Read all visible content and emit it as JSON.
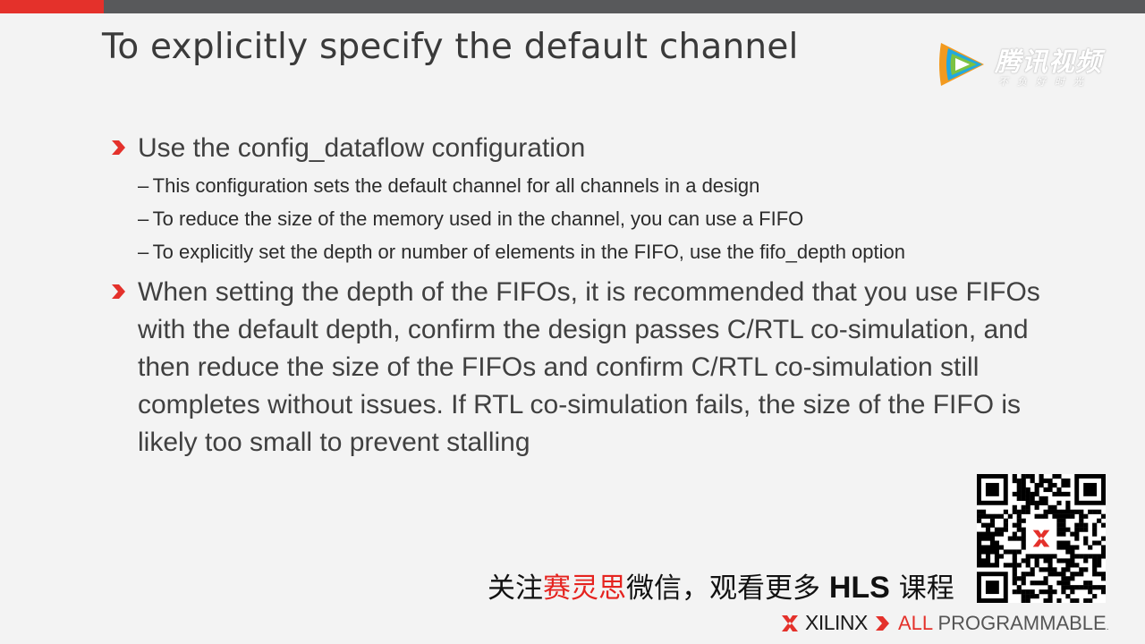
{
  "slide": {
    "title": "To explicitly specify the default channel",
    "bullets": [
      {
        "text": "Use the config_dataflow configuration",
        "subs": [
          "– This configuration sets the default channel for all channels in a design",
          "– To reduce the size of the memory used in the channel, you can use a FIFO",
          "– To explicitly set the depth or number of elements in the FIFO, use the fifo_depth option"
        ]
      },
      {
        "text": "When setting the depth of the FIFOs, it is recommended that you use FIFOs with the default depth, confirm the design passes C/RTL co-simulation, and then reduce the size of the FIFOs and confirm C/RTL co-simulation still completes without issues. If RTL co-simulation fails, the size of the FIFO is likely too small to prevent stalling"
      }
    ]
  },
  "watermark": {
    "name": "腾讯视频",
    "slogan": "不负好时光"
  },
  "promo": {
    "part1": "关注",
    "part2": "赛灵思",
    "part3": "微信，观看更多 ",
    "part4": "HLS",
    "part5": " 课程"
  },
  "footer": {
    "brand": "XILINX",
    "tagline_all": "ALL",
    "tagline_rest": " PROGRAMMABLE",
    "tm": "."
  },
  "colors": {
    "accent_red": "#e4312b",
    "top_bar": "#58595b",
    "background": "#f3f3f3"
  }
}
